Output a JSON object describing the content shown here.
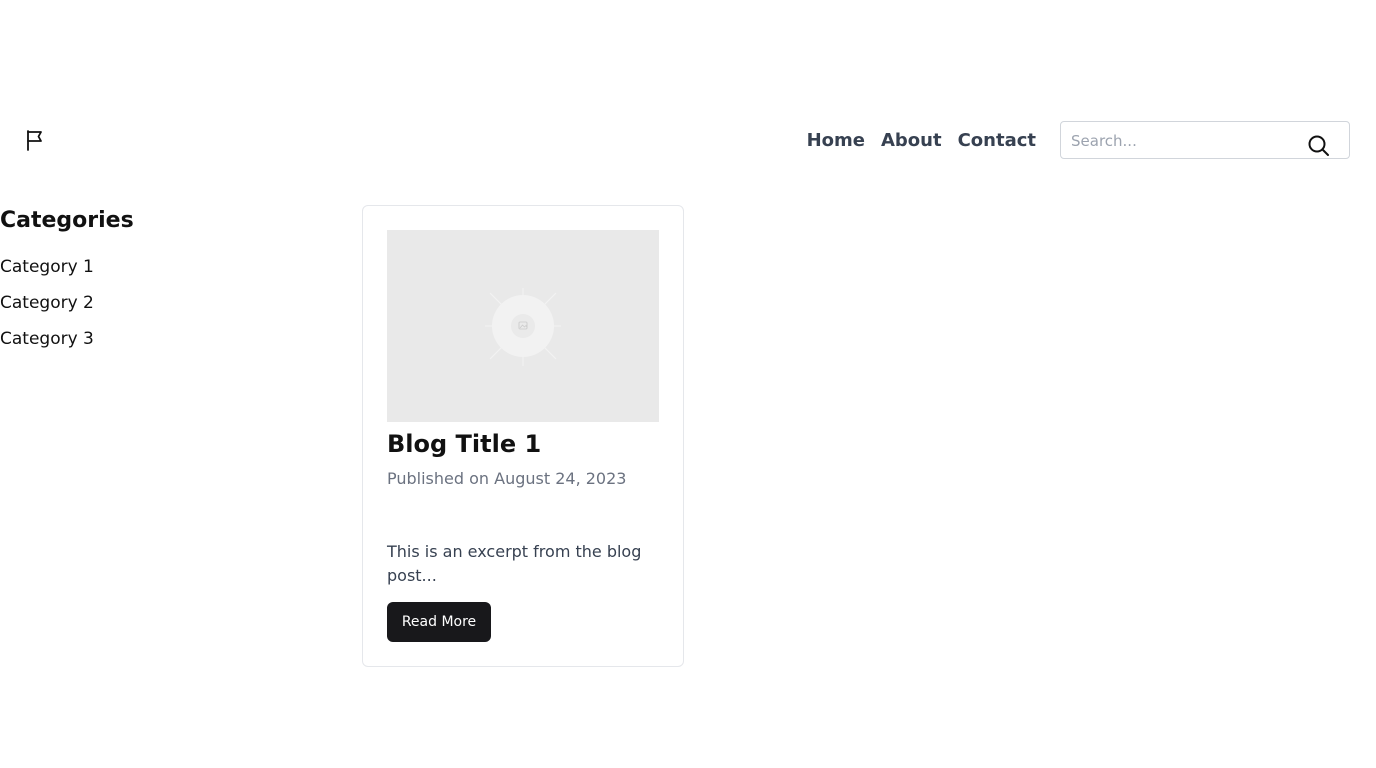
{
  "header": {
    "logo_icon": "flag-icon",
    "nav": [
      "Home",
      "About",
      "Contact"
    ],
    "search": {
      "placeholder": "Search...",
      "value": "",
      "icon": "search-icon"
    }
  },
  "sidebar": {
    "title": "Categories",
    "items": [
      "Category 1",
      "Category 2",
      "Category 3"
    ]
  },
  "posts": [
    {
      "image_icon": "image-placeholder-icon",
      "title": "Blog Title 1",
      "date": "Published on August 24, 2023",
      "excerpt": "This is an excerpt from the blog post...",
      "button_label": "Read More"
    }
  ],
  "colors": {
    "button_bg": "#18181b",
    "nav_text": "#374151",
    "muted_text": "#6b7280",
    "image_bg": "#e9e9e9",
    "card_border": "#e5e7eb"
  }
}
